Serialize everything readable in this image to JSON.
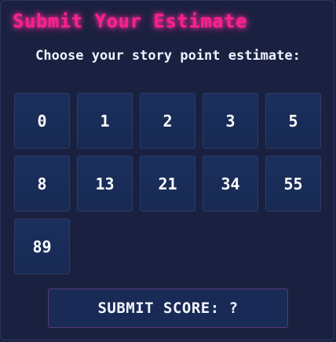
{
  "panel": {
    "title": "Submit Your Estimate",
    "prompt": "Choose your story point estimate:"
  },
  "cards": [
    "0",
    "1",
    "2",
    "3",
    "5",
    "8",
    "13",
    "21",
    "34",
    "55",
    "89"
  ],
  "submit": {
    "label": "SUBMIT SCORE: ?"
  },
  "colors": {
    "title_accent": "#ff1f8e",
    "background": "#1a2140",
    "card_fill": "#1b2f5c"
  }
}
